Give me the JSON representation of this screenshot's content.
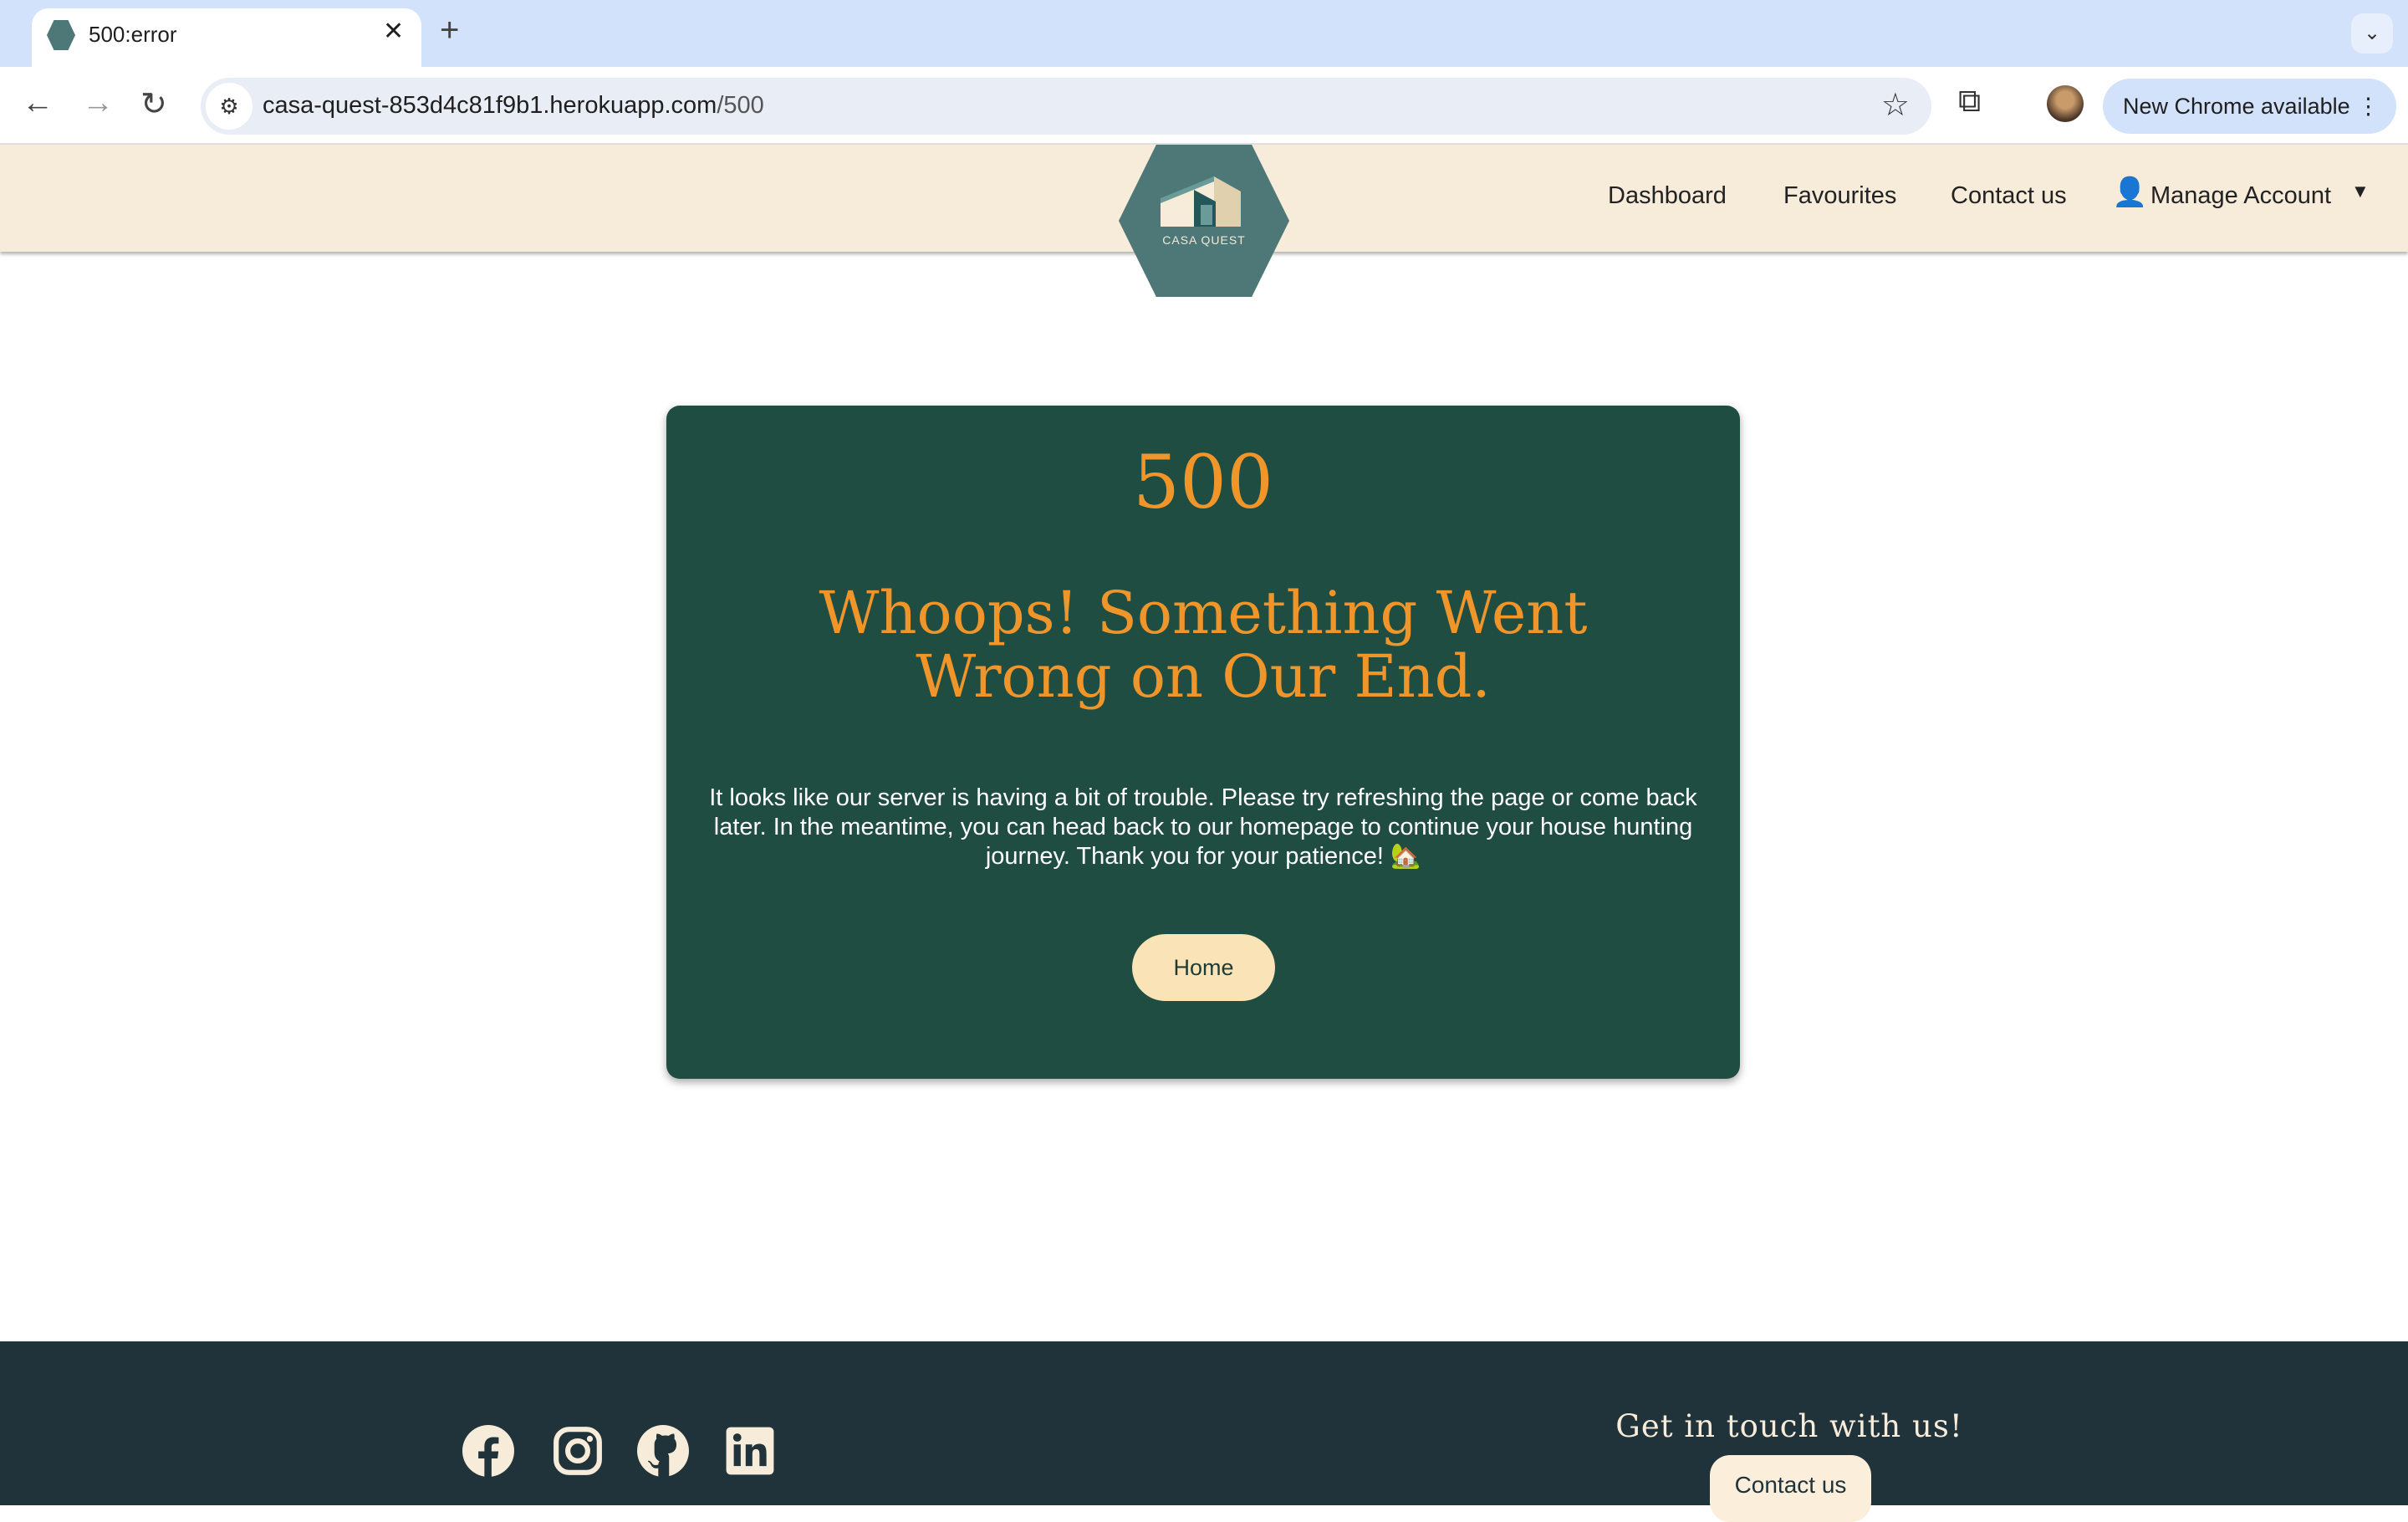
{
  "browser": {
    "tab_title": "500:error",
    "url_host": "casa-quest-853d4c81f9b1.herokuapp.com",
    "url_path": "/500",
    "update_label": "New Chrome available"
  },
  "navbar": {
    "logo_text": "CASA QUEST",
    "links": [
      "Dashboard",
      "Favourites",
      "Contact us",
      "Manage Account"
    ]
  },
  "error": {
    "code": "500",
    "headline": "Whoops! Something Went Wrong on Our End.",
    "message": "It looks like our server is having a bit of trouble. Please try refreshing the page or come back later. In the meantime, you can head back to our homepage to continue your house hunting journey. Thank you for your patience! 🏡",
    "home_label": "Home"
  },
  "footer": {
    "social_icons": [
      "facebook-icon",
      "instagram-icon",
      "github-icon",
      "linkedin-icon"
    ],
    "cta_text": "Get in touch with us!",
    "contact_label": "Contact us"
  },
  "colors": {
    "card": "#1f4d42",
    "accent": "#f0952a",
    "navbar": "#f7ebda",
    "footer": "#20333a",
    "button": "#fbe3b8"
  }
}
